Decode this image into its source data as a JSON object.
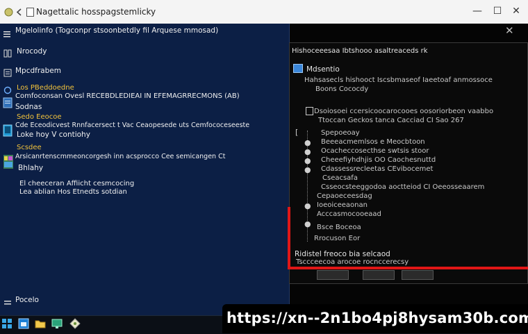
{
  "window": {
    "title": "Nagettalic hosspagstemlicky",
    "min_glyph": "—",
    "max_glyph": "☐",
    "close_glyph": "✕"
  },
  "left_pane": {
    "header": "Mgelolinfo (Togconpr stsoonbetdly fil Arquese mmosad)",
    "items": [
      {
        "icon": "grid-icon",
        "label": "Nrocody"
      },
      {
        "icon": "list-icon",
        "label": "Mpcdfrabem"
      }
    ],
    "sections": [
      {
        "caption": "Los PBeddoedne",
        "line1": "Comfoconsan Ovesl RECEBDLEDIEAI IN EFEMAGRRECMONS (AB)",
        "line2": "Sodnas"
      },
      {
        "caption": "Sedo Eeocoe",
        "line1": "Cde Eceodicvest Rnnfacersect t Vac Ceaopesede uts Cemfococeseeste",
        "line2": "Loke hoy V contiohy"
      },
      {
        "caption": "Scsdee",
        "line1": "Arsicanrtenscmmeoncorgesh inn acsprocco Cee semicangen Ct",
        "line2": "Bhlahy"
      }
    ],
    "note_line1": "El cheeceran Affiicht cesmcocing",
    "note_line2": "Lea ablian Hos Etnedts sotdian",
    "footer": "Pocelo"
  },
  "right_dialog": {
    "header": "Hishoceeesaa Ibtshooo asaltreaceds rk",
    "subheader": "Mdsentio",
    "intro1": "Hahsasecls hishooct Iscsbmaseof Iaeetoaf anmossoce",
    "intro2": "Boons Cococdy",
    "row1a": "Dsoiosoei ccersicoocarocooes oosoriorbeon vaabbo",
    "row1b": "Ttoccan Geckos tanca Cacciad CI Sao 267",
    "tree_items": [
      "Spepoeoay",
      "Beeeacmemlsos e Meocbtoon",
      "Ocacheccosecthse swtsis stoor",
      "Cheeefiyhdhjis OO Caochesnuttd",
      "Cdassessrecleetas CEvibocemet",
      "Cseacsafa",
      "Csseocsteeggodoa aoctteiod CI Oeeosseaarem",
      "Cepaoeceesdag",
      "Ioeoiceeaonan",
      "Acccasmocooeaad",
      "Bsce Boceoa",
      "Rrocuson Eor"
    ],
    "footer1": "Ridistel freoco bia selcaod",
    "footer2": "Tsccceecoa arocoe rocnccerecsy"
  },
  "taskbar": {
    "apps": [
      "windows-icon",
      "store-icon",
      "folder-icon",
      "monitor-icon",
      "diamond-icon"
    ],
    "url": "https://xn--2n1bo4pj8hysam30b.com"
  },
  "colors": {
    "left_bg": "#0c1f45",
    "right_bg": "#050505",
    "highlight": "#e01616",
    "caption": "#f3c33b"
  }
}
